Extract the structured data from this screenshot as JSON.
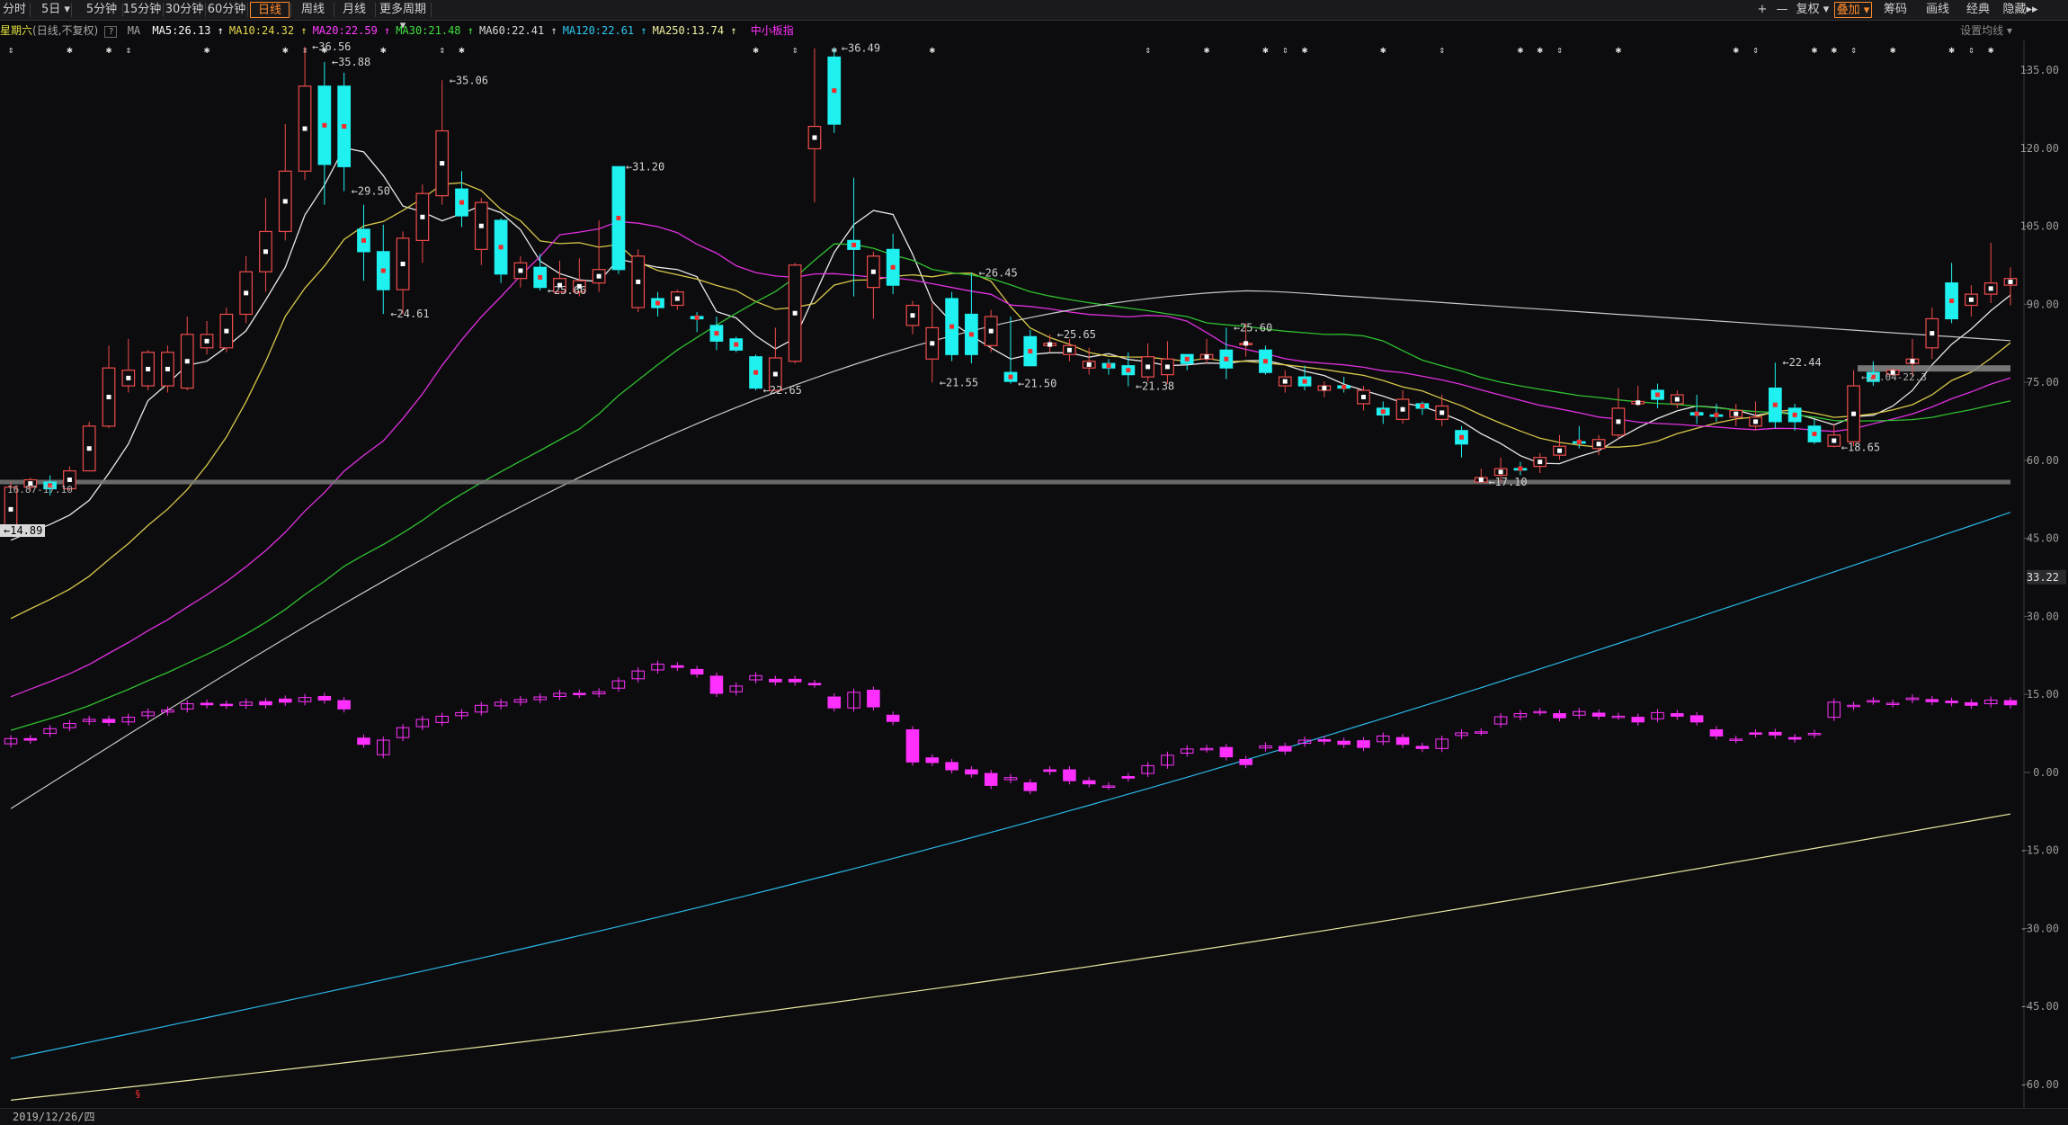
{
  "toolbar": {
    "period_buttons": [
      "分时",
      "5日",
      "5分钟",
      "15分钟",
      "30分钟",
      "60分钟",
      "日线",
      "周线",
      "月线",
      "更多周期"
    ],
    "active_period": "日线",
    "right_buttons": [
      "+",
      "—",
      "复权",
      "叠加",
      "筹码",
      "画线",
      "经典",
      "隐藏▸▸"
    ],
    "active_right": "叠加"
  },
  "infobar": {
    "day": "星期六",
    "mode": "(日线,不复权)",
    "help": "?",
    "ma_label": "MA",
    "ma": [
      {
        "label": "MA5:26.13",
        "color": "#ffffff"
      },
      {
        "label": "MA10:24.32",
        "color": "#e6d84a"
      },
      {
        "label": "MA20:22.59",
        "color": "#ff3cff"
      },
      {
        "label": "MA30:21.48",
        "color": "#3fe03f"
      },
      {
        "label": "MA60:22.41",
        "color": "#d8d8d8"
      },
      {
        "label": "MA120:22.61",
        "color": "#2ec8f0"
      },
      {
        "label": "MA250:13.74",
        "color": "#f0f0a0"
      }
    ],
    "indicator": "中小板指",
    "settings": "设置均线"
  },
  "bottombar": {
    "date": "2019/12/26/四"
  },
  "chart_data": {
    "type": "candlestick",
    "right_axis": {
      "ticks": [
        135.0,
        120.0,
        105.0,
        90.0,
        75.0,
        60.0,
        45.0,
        30.0,
        15.0,
        0.0,
        -15.0,
        -30.0,
        -45.0,
        -60.0
      ],
      "current": "33.22"
    },
    "upper_scale": {
      "price_at_y": [
        36.56,
        14.89
      ]
    },
    "candles": [
      [
        14.89,
        16.87,
        17.1,
        14.89,
        "up"
      ],
      [
        16.87,
        17.2,
        17.3,
        16.7,
        "up"
      ],
      [
        17.1,
        16.8,
        17.4,
        16.5,
        "down"
      ],
      [
        16.8,
        17.6,
        17.8,
        16.7,
        "up"
      ],
      [
        17.6,
        19.6,
        19.8,
        17.6,
        "up"
      ],
      [
        19.6,
        22.2,
        23.2,
        19.5,
        "up"
      ],
      [
        22.1,
        21.4,
        23.5,
        21.1,
        "up"
      ],
      [
        21.4,
        22.9,
        23.0,
        21.2,
        "up"
      ],
      [
        22.9,
        21.4,
        23.2,
        21.1,
        "up"
      ],
      [
        21.3,
        23.7,
        24.5,
        21.2,
        "up"
      ],
      [
        23.7,
        23.1,
        24.3,
        22.8,
        "up"
      ],
      [
        23.1,
        24.6,
        24.9,
        22.9,
        "up"
      ],
      [
        24.6,
        26.5,
        27.2,
        24.2,
        "up"
      ],
      [
        26.5,
        28.3,
        29.8,
        25.6,
        "up"
      ],
      [
        28.3,
        31.0,
        33.1,
        27.9,
        "up"
      ],
      [
        31.0,
        34.8,
        36.56,
        30.6,
        "up"
      ],
      [
        34.8,
        31.3,
        35.88,
        29.5,
        "down"
      ],
      [
        31.2,
        34.8,
        35.4,
        30.1,
        "down"
      ],
      [
        28.4,
        27.4,
        29.5,
        26.1,
        "down"
      ],
      [
        27.4,
        25.7,
        28.6,
        24.61,
        "down"
      ],
      [
        25.7,
        28.0,
        28.3,
        24.61,
        "up"
      ],
      [
        27.9,
        30.0,
        30.4,
        26.9,
        "up"
      ],
      [
        29.9,
        32.8,
        35.06,
        29.5,
        "up"
      ],
      [
        30.2,
        29.0,
        31.0,
        28.5,
        "down"
      ],
      [
        29.6,
        27.5,
        29.8,
        26.8,
        "up"
      ],
      [
        28.8,
        26.4,
        28.9,
        26.0,
        "down"
      ],
      [
        26.9,
        26.2,
        27.2,
        25.8,
        "up"
      ],
      [
        26.7,
        25.8,
        27.3,
        25.66,
        "down"
      ],
      [
        25.6,
        26.2,
        27.0,
        25.66,
        "up"
      ],
      [
        25.6,
        26.1,
        27.1,
        25.4,
        "up"
      ],
      [
        26.6,
        26.0,
        28.8,
        25.6,
        "up"
      ],
      [
        26.6,
        31.2,
        31.2,
        26.4,
        "down"
      ],
      [
        27.2,
        24.9,
        27.5,
        24.7,
        "up"
      ],
      [
        24.9,
        25.3,
        25.6,
        24.5,
        "down"
      ],
      [
        25.0,
        25.6,
        25.7,
        24.8,
        "up"
      ],
      [
        24.5,
        24.4,
        24.7,
        23.8,
        "down"
      ],
      [
        24.1,
        23.4,
        24.5,
        23.0,
        "down"
      ],
      [
        23.0,
        23.5,
        23.6,
        22.9,
        "down"
      ],
      [
        22.7,
        21.3,
        22.8,
        21.2,
        "down"
      ],
      [
        21.2,
        22.65,
        24.0,
        22.65,
        "up"
      ],
      [
        22.5,
        26.8,
        26.9,
        22.4,
        "up"
      ],
      [
        32.0,
        33.0,
        36.49,
        29.6,
        "up"
      ],
      [
        36.1,
        33.1,
        36.49,
        32.7,
        "down"
      ],
      [
        27.9,
        27.5,
        30.7,
        25.4,
        "down"
      ],
      [
        27.2,
        25.8,
        27.4,
        24.4,
        "up"
      ],
      [
        27.5,
        25.9,
        28.2,
        25.5,
        "down"
      ],
      [
        25.0,
        24.1,
        25.2,
        23.7,
        "up"
      ],
      [
        24.0,
        22.6,
        25.1,
        21.55,
        "up"
      ],
      [
        25.3,
        22.8,
        25.6,
        22.5,
        "down"
      ],
      [
        24.6,
        22.8,
        26.45,
        22.4,
        "down"
      ],
      [
        24.5,
        23.2,
        24.8,
        22.9,
        "up"
      ],
      [
        22.0,
        21.6,
        24.5,
        21.5,
        "down"
      ],
      [
        22.3,
        23.6,
        23.9,
        22.3,
        "down"
      ],
      [
        23.3,
        23.2,
        23.7,
        22.9,
        "up"
      ],
      [
        23.2,
        22.8,
        23.5,
        22.5,
        "up"
      ],
      [
        22.5,
        22.2,
        23.1,
        21.9,
        "up"
      ],
      [
        22.2,
        22.4,
        22.6,
        21.9,
        "down"
      ],
      [
        21.9,
        22.3,
        22.9,
        21.38,
        "down"
      ],
      [
        21.8,
        22.7,
        23.3,
        21.6,
        "up"
      ],
      [
        22.6,
        21.9,
        23.4,
        21.5,
        "up"
      ],
      [
        22.8,
        22.4,
        22.8,
        22.1,
        "down"
      ],
      [
        22.6,
        22.8,
        23.5,
        22.4,
        "up"
      ],
      [
        23.0,
        22.2,
        24.0,
        21.7,
        "down"
      ],
      [
        23.3,
        23.3,
        24.2,
        22.7,
        "up"
      ],
      [
        23.0,
        22.0,
        23.2,
        21.9,
        "down"
      ],
      [
        21.8,
        21.4,
        22.1,
        21.1,
        "up"
      ],
      [
        21.8,
        21.4,
        22.3,
        21.2,
        "down"
      ],
      [
        21.4,
        21.2,
        21.6,
        20.9,
        "up"
      ],
      [
        21.3,
        21.4,
        21.8,
        21.1,
        "down"
      ],
      [
        21.2,
        20.6,
        21.4,
        20.3,
        "up"
      ],
      [
        20.4,
        20.1,
        20.7,
        19.7,
        "down"
      ],
      [
        20.8,
        19.9,
        21.2,
        19.7,
        "up"
      ],
      [
        20.6,
        20.4,
        20.7,
        20.1,
        "down"
      ],
      [
        20.5,
        19.9,
        21.0,
        19.6,
        "up"
      ],
      [
        19.4,
        18.8,
        19.6,
        18.2,
        "down"
      ],
      [
        17.1,
        17.3,
        17.7,
        17.1,
        "up"
      ],
      [
        17.4,
        17.7,
        18.2,
        17.1,
        "up"
      ],
      [
        17.7,
        17.7,
        18.0,
        17.4,
        "down"
      ],
      [
        17.8,
        18.2,
        18.4,
        17.5,
        "up"
      ],
      [
        18.3,
        18.7,
        19.2,
        18.1,
        "up"
      ],
      [
        18.9,
        18.9,
        19.6,
        18.6,
        "down"
      ],
      [
        18.6,
        19.0,
        19.2,
        18.3,
        "up"
      ],
      [
        19.2,
        20.4,
        21.3,
        19.0,
        "up"
      ],
      [
        20.7,
        20.6,
        21.4,
        20.5,
        "up"
      ],
      [
        21.2,
        20.8,
        21.5,
        20.4,
        "down"
      ],
      [
        21.0,
        20.6,
        21.2,
        20.4,
        "up"
      ],
      [
        20.2,
        20.1,
        21.0,
        19.7,
        "down"
      ],
      [
        20.1,
        20.1,
        20.6,
        19.8,
        "down"
      ],
      [
        20.3,
        20.0,
        20.6,
        19.6,
        "up"
      ],
      [
        20.0,
        19.6,
        20.7,
        19.4,
        "up"
      ],
      [
        19.8,
        21.3,
        22.44,
        19.5,
        "down"
      ],
      [
        20.4,
        19.8,
        20.6,
        19.4,
        "down"
      ],
      [
        19.6,
        18.9,
        19.9,
        18.8,
        "down"
      ],
      [
        19.2,
        18.7,
        19.7,
        18.65,
        "up"
      ],
      [
        18.9,
        21.4,
        22.1,
        18.7,
        "up"
      ],
      [
        22.0,
        21.6,
        22.5,
        21.4,
        "down"
      ],
      [
        22.1,
        21.9,
        22.2,
        21.8,
        "up"
      ],
      [
        22.6,
        22.4,
        23.5,
        21.8,
        "up"
      ],
      [
        23.1,
        24.4,
        24.9,
        22.6,
        "up"
      ],
      [
        24.4,
        26.0,
        26.9,
        24.2,
        "down"
      ],
      [
        25.5,
        25.0,
        25.9,
        24.5,
        "up"
      ],
      [
        25.5,
        26.0,
        27.8,
        25.1,
        "up"
      ],
      [
        26.2,
        25.9,
        26.7,
        25.0,
        "up"
      ]
    ],
    "annotations": [
      {
        "index": 15,
        "value": "36.56",
        "side": "high"
      },
      {
        "index": 16,
        "value": "35.88",
        "side": "high"
      },
      {
        "index": 17,
        "value": "29.50",
        "side": "low"
      },
      {
        "index": 19,
        "value": "24.61",
        "side": "low"
      },
      {
        "index": 22,
        "value": "35.06",
        "side": "high"
      },
      {
        "index": 27,
        "value": "25.66",
        "side": "low"
      },
      {
        "index": 31,
        "value": "31.20",
        "side": "high"
      },
      {
        "index": 38,
        "value": "22.65",
        "side": "low"
      },
      {
        "index": 42,
        "value": "36.49",
        "side": "high"
      },
      {
        "index": 47,
        "value": "21.55",
        "side": "low"
      },
      {
        "index": 49,
        "value": "26.45",
        "side": "high"
      },
      {
        "index": 51,
        "value": "21.50",
        "side": "low"
      },
      {
        "index": 53,
        "value": "25.65",
        "side": "high"
      },
      {
        "index": 57,
        "value": "21.38",
        "side": "low"
      },
      {
        "index": 62,
        "value": "25.60",
        "side": "high"
      },
      {
        "index": 75,
        "value": "17.10",
        "side": "low"
      },
      {
        "index": 90,
        "value": "22.44",
        "side": "high"
      },
      {
        "index": 93,
        "value": "18.65",
        "side": "low"
      }
    ],
    "lower_boxes_labels": [
      "16.87-17.10",
      "22.04-22.3"
    ],
    "left_price_label": "14.89",
    "series": [
      {
        "name": "MA5",
        "color": "#e8e8e8"
      },
      {
        "name": "MA10",
        "color": "#d8c84a"
      },
      {
        "name": "MA20",
        "color": "#e030e0"
      },
      {
        "name": "MA30",
        "color": "#2fc02f"
      },
      {
        "name": "MA60",
        "color": "#c8c8c8"
      },
      {
        "name": "MA120",
        "color": "#2ab8e8"
      },
      {
        "name": "MA250",
        "color": "#e8e8a0"
      }
    ],
    "overlay": {
      "name": "中小板指",
      "color": "#ff30ff"
    }
  }
}
